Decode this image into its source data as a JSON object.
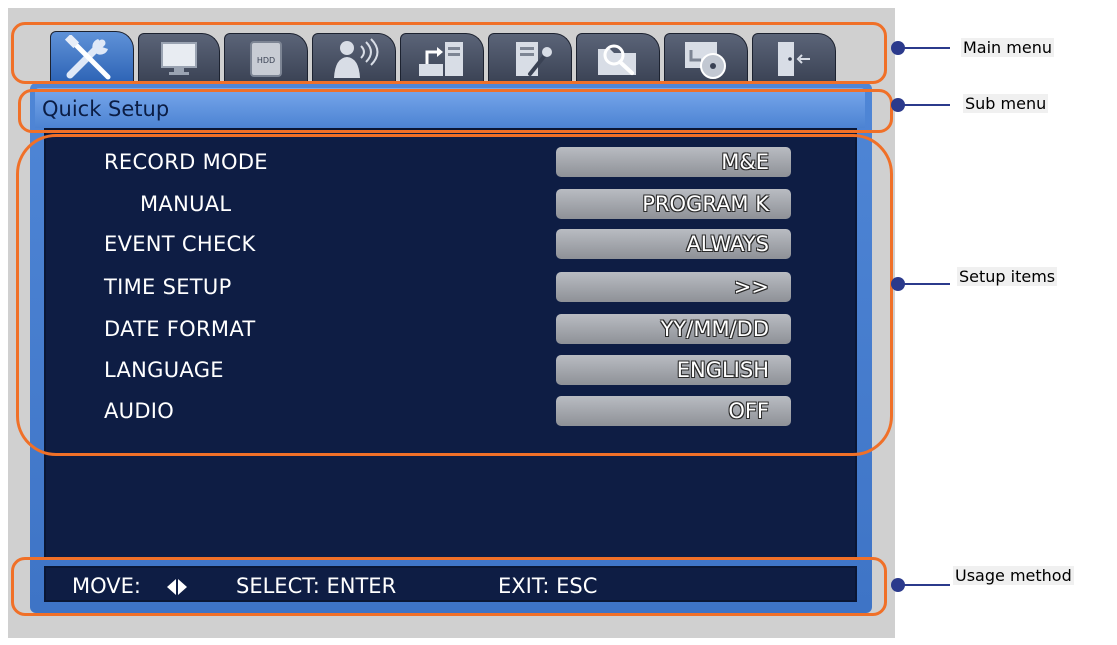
{
  "main_menu": {
    "tabs": [
      {
        "icon": "tools-icon",
        "active": true
      },
      {
        "icon": "monitor-icon",
        "active": false
      },
      {
        "icon": "hdd-icon",
        "label": "HDD",
        "active": false
      },
      {
        "icon": "person-signal-icon",
        "active": false
      },
      {
        "icon": "network-transfer-icon",
        "active": false
      },
      {
        "icon": "system-check-icon",
        "active": false
      },
      {
        "icon": "search-folder-icon",
        "active": false
      },
      {
        "icon": "backup-disc-icon",
        "active": false
      },
      {
        "icon": "exit-door-icon",
        "active": false
      }
    ]
  },
  "sub_menu": {
    "title": "Quick Setup"
  },
  "setup_items": [
    {
      "label": "RECORD MODE",
      "value": "M&E"
    },
    {
      "label": "MANUAL",
      "value": "PROGRAM K"
    },
    {
      "label": "EVENT CHECK",
      "value": "ALWAYS"
    },
    {
      "label": "TIME SETUP",
      "value": ">>"
    },
    {
      "label": "DATE FORMAT",
      "value": "YY/MM/DD"
    },
    {
      "label": "LANGUAGE",
      "value": "ENGLISH"
    },
    {
      "label": "AUDIO",
      "value": "OFF"
    }
  ],
  "usage": {
    "move": "MOVE:",
    "select": "SELECT: ENTER",
    "exit": "EXIT: ESC"
  },
  "callouts": {
    "main_menu": "Main menu",
    "sub_menu": "Sub menu",
    "setup_items": "Setup items",
    "usage_method": "Usage method"
  },
  "colors": {
    "highlight": "#f07028",
    "panel_blue": "#4f86d6",
    "inner_navy": "#0e1d44",
    "callout_line": "#2b3a8c"
  }
}
